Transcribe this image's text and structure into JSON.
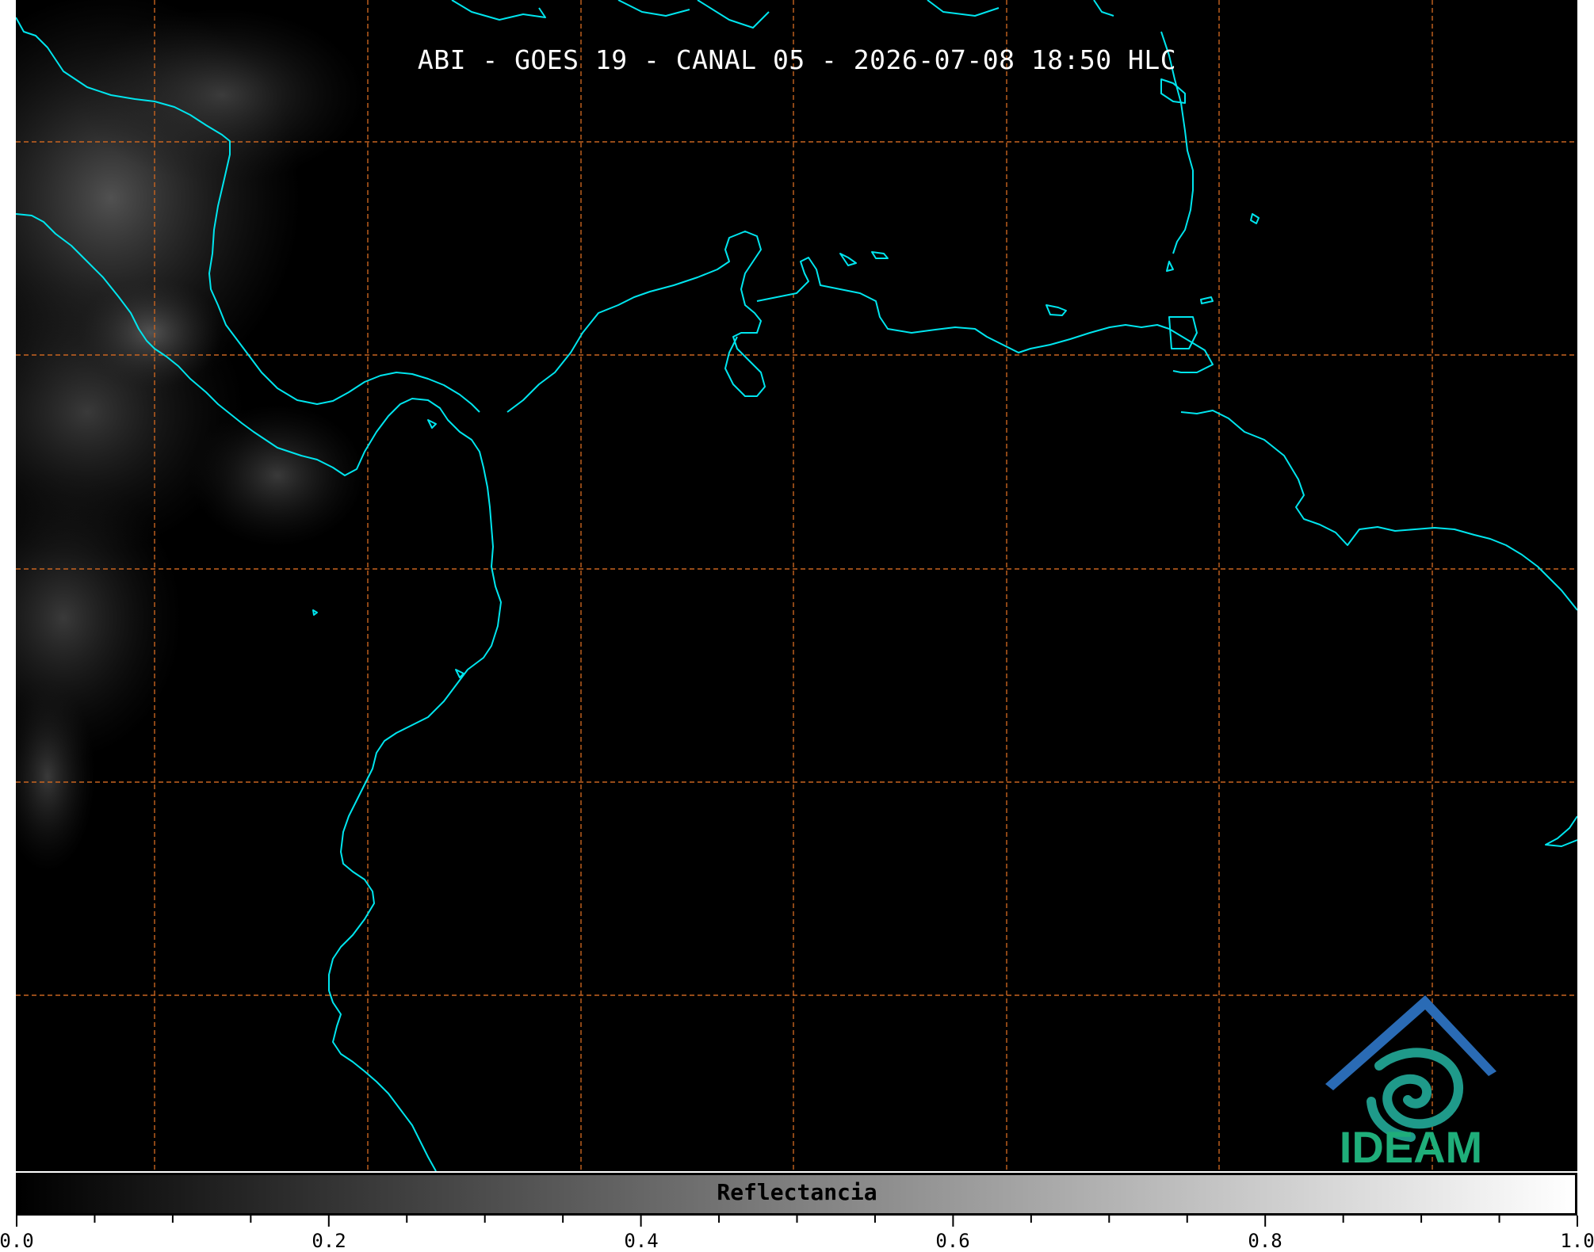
{
  "title": "ABI - GOES 19 - CANAL 05 - 2026-07-08 18:50 HLC",
  "colorbar": {
    "label": "Reflectancia",
    "tick_labels": [
      "0.0",
      "0.2",
      "0.4",
      "0.6",
      "0.8",
      "1.0"
    ],
    "min_color": "#000000",
    "max_color": "#ffffff"
  },
  "logo": {
    "text": "IDEAM",
    "text_color": "#1fae7a",
    "roof_color": "#2a6bb5",
    "swirl_color": "#1f9a8a"
  },
  "colors": {
    "coastline": "#00e5ee",
    "gridline": "#c86420",
    "background": "#000000"
  }
}
